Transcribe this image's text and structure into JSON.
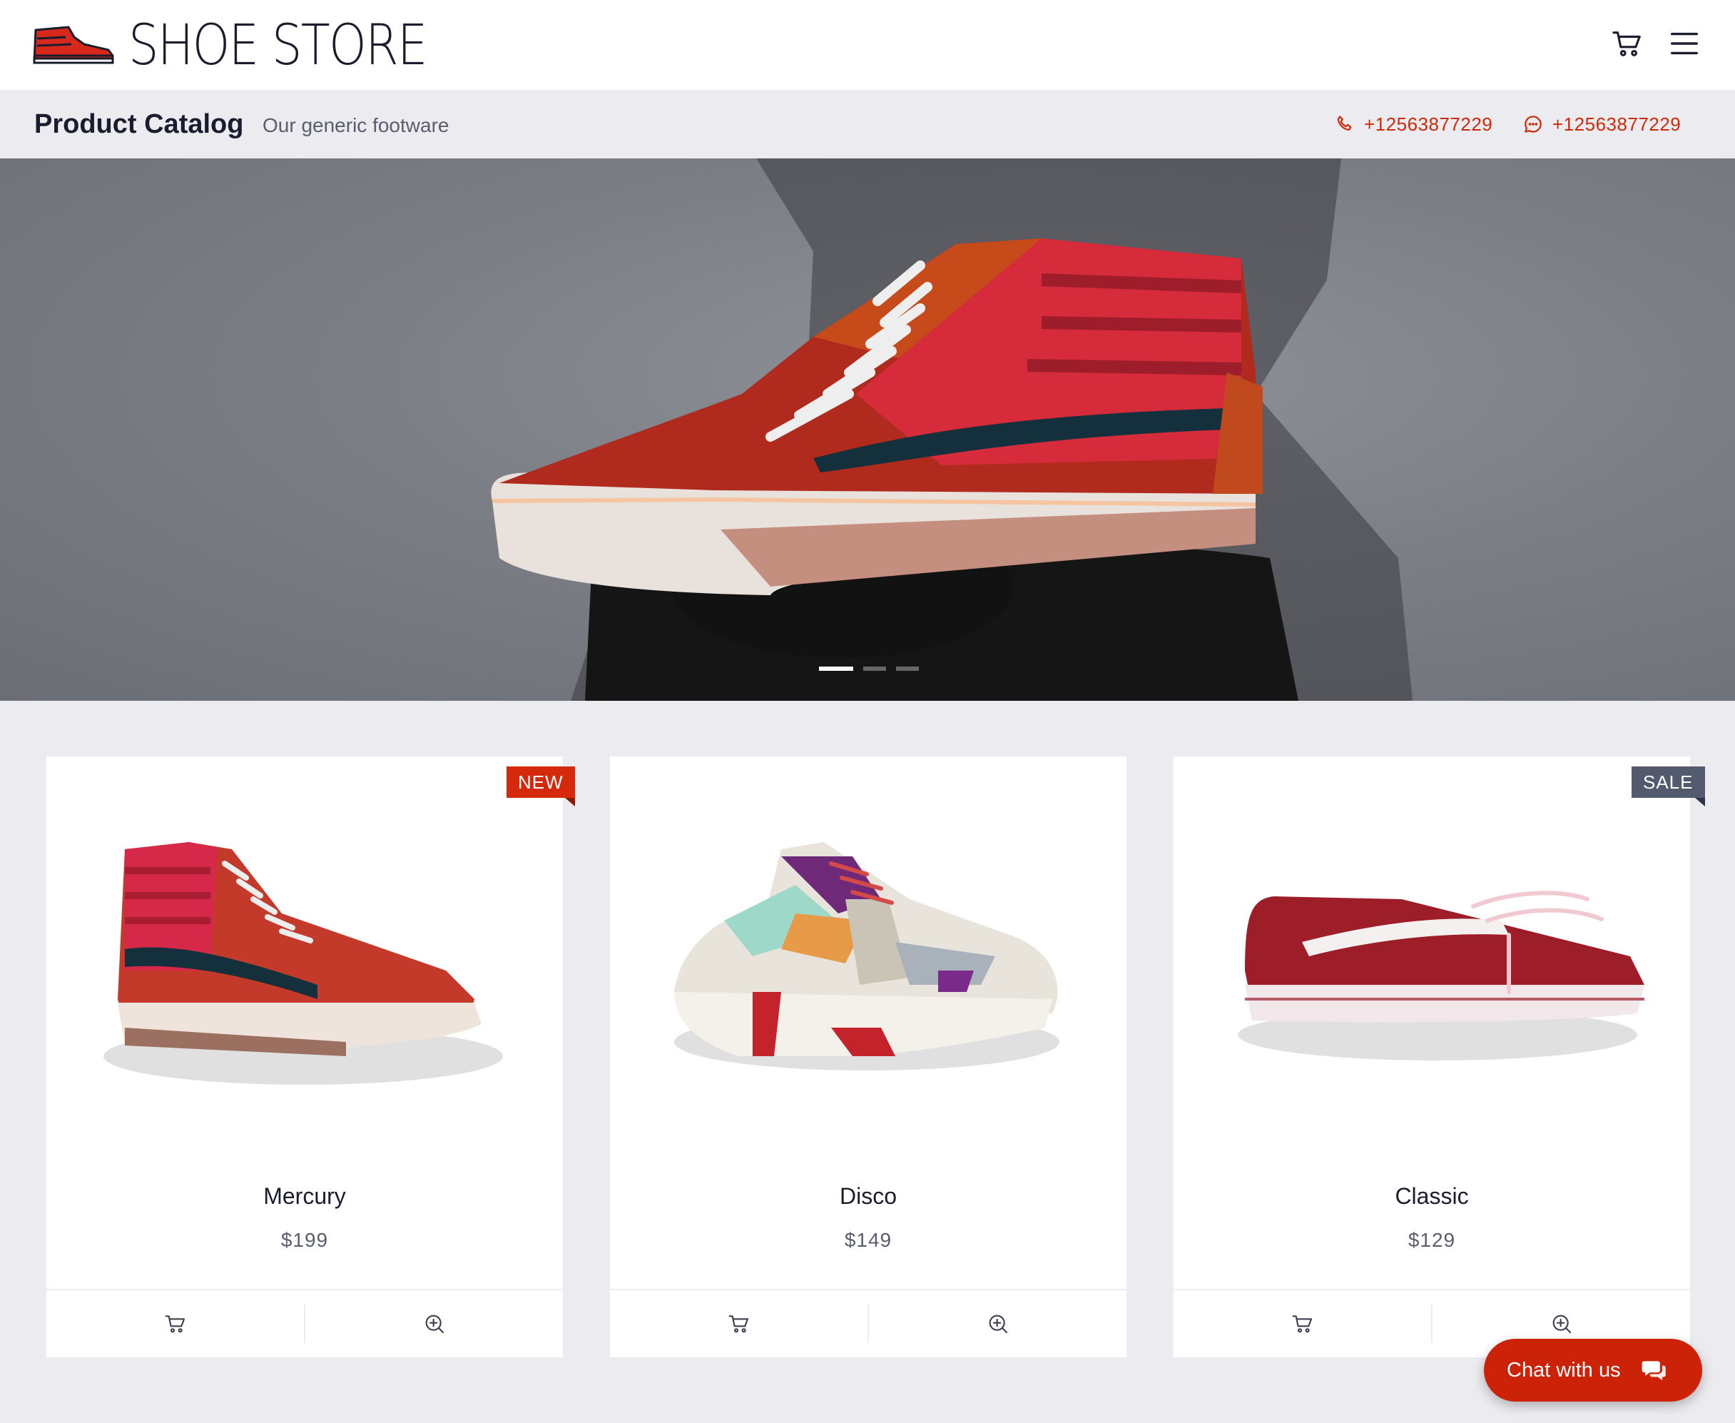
{
  "header": {
    "brand": "SHOE STORE",
    "logo_icon": "sneaker-logo-icon",
    "cart_icon": "cart-icon",
    "menu_icon": "hamburger-menu-icon"
  },
  "subheader": {
    "title": "Product Catalog",
    "subtitle": "Our generic footware",
    "phone": "+12563877229",
    "chat_phone": "+12563877229"
  },
  "hero": {
    "slides_total": 3,
    "active_slide": 1
  },
  "products": [
    {
      "name": "Mercury",
      "price": "$199",
      "badge": "NEW"
    },
    {
      "name": "Disco",
      "price": "$149",
      "badge": ""
    },
    {
      "name": "Classic",
      "price": "$129",
      "badge": "SALE"
    }
  ],
  "chat": {
    "label": "Chat with us"
  },
  "colors": {
    "accent": "#cc2208",
    "badge_new": "#d4290a",
    "badge_sale": "#535a6e",
    "page_bg": "#ebebf0"
  }
}
